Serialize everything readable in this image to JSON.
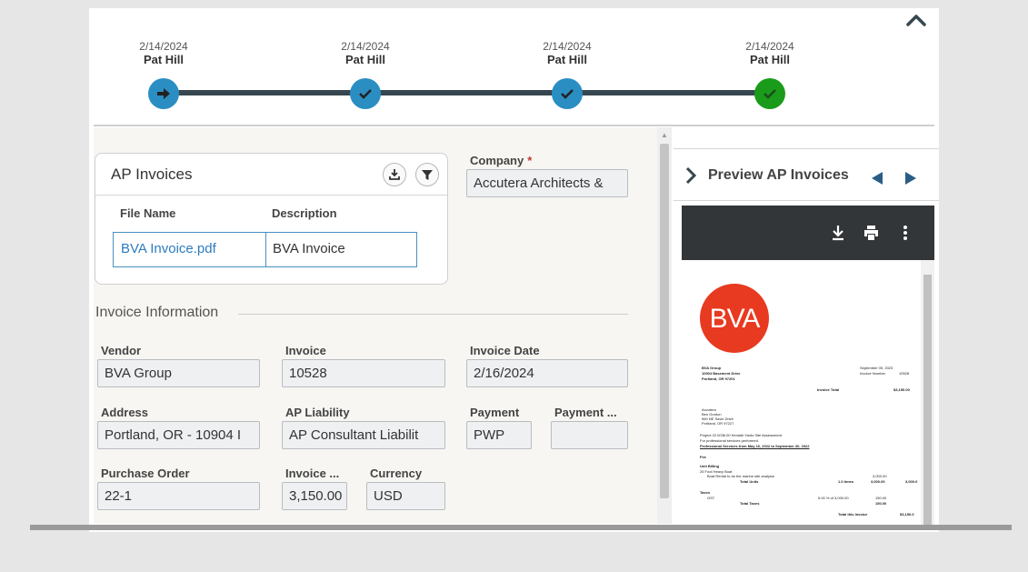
{
  "workflow": {
    "steps": [
      {
        "date": "2/14/2024",
        "name": "Pat Hill",
        "status": "current",
        "icon": "arrow-right-icon"
      },
      {
        "date": "2/14/2024",
        "name": "Pat Hill",
        "status": "approved",
        "icon": "check-icon"
      },
      {
        "date": "2/14/2024",
        "name": "Pat Hill",
        "status": "approved",
        "icon": "check-icon"
      },
      {
        "date": "2/14/2024",
        "name": "Pat Hill",
        "status": "complete",
        "icon": "check-icon"
      }
    ],
    "colors": {
      "step": "#2b8ec3",
      "complete": "#1a9c1a",
      "line": "#37474f"
    }
  },
  "ap_invoices": {
    "title": "AP Invoices",
    "columns": [
      "File Name",
      "Description"
    ],
    "rows": [
      {
        "file_name": "BVA Invoice.pdf",
        "description": "BVA Invoice"
      }
    ]
  },
  "company": {
    "label": "Company",
    "required_mark": "*",
    "value": "Accutera Architects &"
  },
  "invoice_info": {
    "title": "Invoice Information",
    "vendor": {
      "label": "Vendor",
      "value": "BVA Group"
    },
    "invoice": {
      "label": "Invoice",
      "value": "10528"
    },
    "invoice_date": {
      "label": "Invoice Date",
      "value": "2/16/2024"
    },
    "address": {
      "label": "Address",
      "value": "Portland, OR - 10904 I"
    },
    "ap_liability": {
      "label": "AP Liability",
      "value": "AP Consultant Liabilit"
    },
    "payment": {
      "label": "Payment",
      "value": "PWP"
    },
    "payment_extra": {
      "label": "Payment ...",
      "value": ""
    },
    "purchase_order": {
      "label": "Purchase Order",
      "value": "22-1"
    },
    "invoice_amount": {
      "label": "Invoice ...",
      "value": "3,150.00"
    },
    "currency": {
      "label": "Currency",
      "value": "USD"
    }
  },
  "preview": {
    "title": "Preview AP Invoices",
    "document": {
      "logo_text": "BVA",
      "vendor_lines": [
        "BVA Group",
        "10904 Basement Drive",
        "Portland, OR 97201"
      ],
      "date": "September 05, 2023",
      "invoice_number_label": "Invoice Number",
      "invoice_number": "10528",
      "invoice_total_label": "Invoice Total",
      "invoice_total": "$3,150.00",
      "client_lines": [
        "Accutera",
        "Ben Gordon",
        "960 NE Savie Drive",
        "Portland, OR 97227"
      ],
      "project_line": "Project      22.0036.00      Kendall Yards Site Assessment",
      "services_line": "For professional services performed.",
      "period_line": "Professional Services from May 16, 2022 to September 30, 2022",
      "fee_label": "Fee",
      "unit_billing_label": "Unit Billing",
      "unit_item": "25 Foot Heavy Boat",
      "unit_desc": "Boat Rental to do the marine site analysis",
      "total_units_label": "Total Units",
      "units_qty": "1.0 times",
      "units_rate": "3,000.00",
      "units_amt": "3,000.0",
      "taxes_label": "Taxes",
      "gst_label": "GST",
      "gst_calc": "5.00 % of 3,000.00",
      "gst_amt": "150.00",
      "total_taxes_label": "Total Taxes",
      "total_taxes": "150.00",
      "total_invoice_label": "Total this Invoice",
      "total_invoice": "$3,150.0"
    }
  }
}
